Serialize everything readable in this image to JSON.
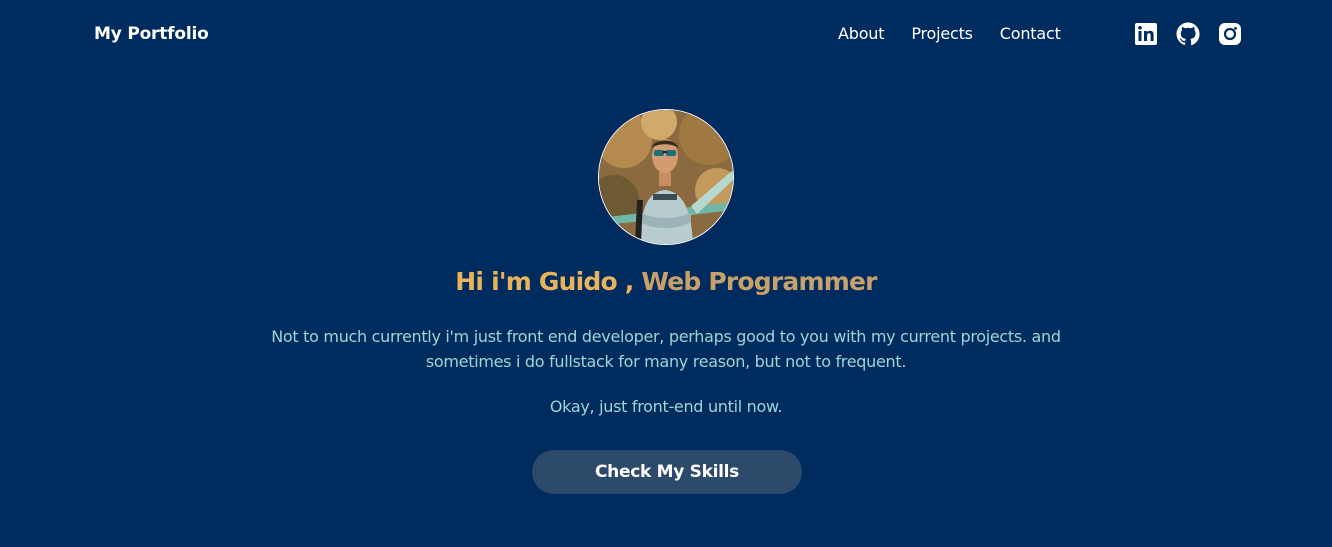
{
  "header": {
    "brand": "My Portfolio",
    "nav": [
      {
        "label": "About"
      },
      {
        "label": "Projects"
      },
      {
        "label": "Contact"
      }
    ],
    "social": [
      "linkedin-icon",
      "github-icon",
      "instagram-icon"
    ]
  },
  "hero": {
    "headline_part1": "Hi i'm Guido ,",
    "headline_part2": "Web Programmer",
    "intro": "Not to much currently i'm just front end developer, perhaps good to you with my current projects. and sometimes i do fullstack for many reason, but not to frequent.",
    "note": "Okay, just front-end until now.",
    "cta_label": "Check My Skills"
  },
  "colors": {
    "background": "#002b5e",
    "headline_gold": "#e9b35a",
    "body_text": "#9ed4d4",
    "button_bg": "#2e4a6b"
  }
}
